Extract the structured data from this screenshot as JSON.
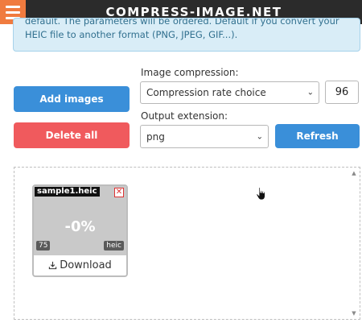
{
  "header": {
    "brand": "COMPRESS-IMAGE.NET",
    "menu_icon": "hamburger-menu-icon",
    "menu_color": "#f07b3f"
  },
  "info": {
    "line1": "default. The parameters will be ordered. Default if you convert your",
    "line2": "HEIC file to another format (PNG, JPEG, GIF...)."
  },
  "controls": {
    "add_label": "Add images",
    "delete_label": "Delete all",
    "refresh_label": "Refresh",
    "compression_label": "Image compression:",
    "compression_value": "Compression rate choice",
    "quality_value": "96",
    "extension_label": "Output extension:",
    "extension_value": "png"
  },
  "file": {
    "name": "sample1.heic",
    "ratio": "-0%",
    "quality": "75",
    "extension": "heic",
    "download_label": "Download"
  },
  "colors": {
    "primary": "#3a8fd9",
    "danger": "#f05a5d",
    "header": "#2b2b2b"
  }
}
